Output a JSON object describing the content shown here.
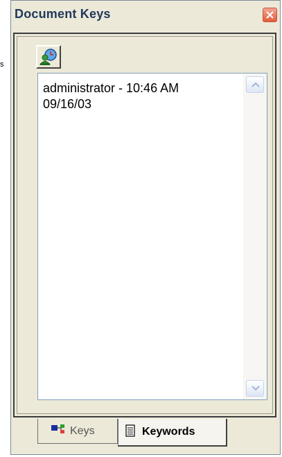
{
  "stray_text": "s",
  "panel": {
    "title": "Document Keys"
  },
  "toolbar": {
    "button_icon": "user-clock-icon"
  },
  "list": {
    "entry": "administrator - 10:46 AM\n09/16/03"
  },
  "tabs": [
    {
      "label": "Keys",
      "icon": "keys-icon",
      "active": false
    },
    {
      "label": "Keywords",
      "icon": "document-lines-icon",
      "active": true
    }
  ],
  "colors": {
    "title": "#21395c",
    "close_button": "#e35a3c",
    "panel_bg": "#ece9d8"
  }
}
